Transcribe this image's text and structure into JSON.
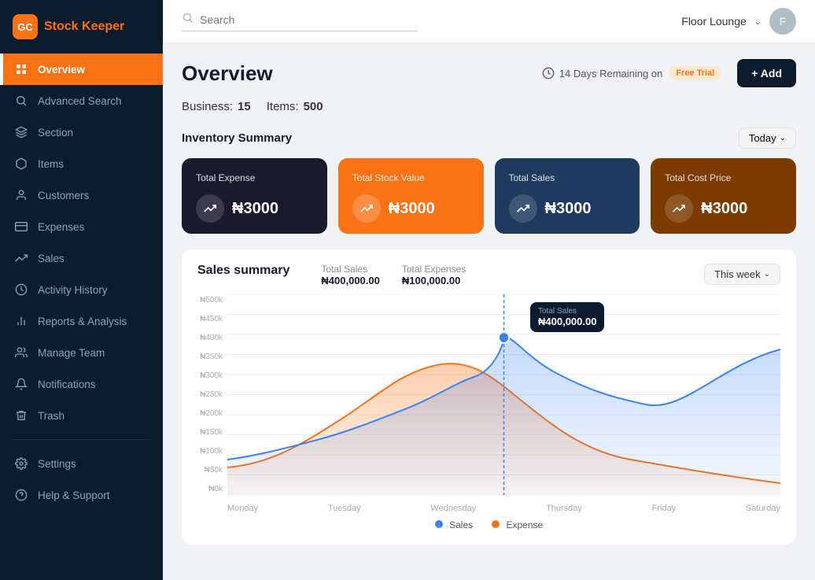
{
  "app": {
    "logo_icon": "GC",
    "logo_name_part1": "Stock",
    "logo_name_part2": "Keeper"
  },
  "sidebar": {
    "items": [
      {
        "id": "overview",
        "label": "Overview",
        "icon": "grid",
        "active": true
      },
      {
        "id": "advanced-search",
        "label": "Advanced Search",
        "icon": "search"
      },
      {
        "id": "section",
        "label": "Section",
        "icon": "layers"
      },
      {
        "id": "items",
        "label": "Items",
        "icon": "box"
      },
      {
        "id": "customers",
        "label": "Customers",
        "icon": "user-circle"
      },
      {
        "id": "expenses",
        "label": "Expenses",
        "icon": "credit-card"
      },
      {
        "id": "sales",
        "label": "Sales",
        "icon": "trending-up"
      },
      {
        "id": "activity-history",
        "label": "Activity History",
        "icon": "clock"
      },
      {
        "id": "reports-analysis",
        "label": "Reports & Analysis",
        "icon": "bar-chart"
      },
      {
        "id": "manage-team",
        "label": "Manage Team",
        "icon": "users"
      },
      {
        "id": "notifications",
        "label": "Notifications",
        "icon": "bell"
      },
      {
        "id": "trash",
        "label": "Trash",
        "icon": "trash"
      }
    ],
    "bottom_items": [
      {
        "id": "settings",
        "label": "Settings",
        "icon": "settings"
      },
      {
        "id": "help-support",
        "label": "Help & Support",
        "icon": "help-circle"
      }
    ]
  },
  "header": {
    "search_placeholder": "Search",
    "user_name": "Floor Lounge",
    "avatar_initial": "F"
  },
  "page": {
    "title": "Overview",
    "trial_text": "14 Days Remaining on",
    "trial_badge": "Free Trial",
    "add_button": "+ Add"
  },
  "stats": {
    "business_label": "Business:",
    "business_value": "15",
    "items_label": "Items:",
    "items_value": "500"
  },
  "inventory_summary": {
    "title": "Inventory Summary",
    "filter": "Today",
    "cards": [
      {
        "label": "Total Expense",
        "amount": "₦3000",
        "style": "black",
        "icon": "↗"
      },
      {
        "label": "Total Stock Value",
        "amount": "₦3000",
        "style": "orange",
        "icon": "↗"
      },
      {
        "label": "Total  Sales",
        "amount": "₦3000",
        "style": "navy",
        "icon": "↗"
      },
      {
        "label": "Total Cost Price",
        "amount": "₦3000",
        "style": "brown",
        "icon": "↗"
      }
    ]
  },
  "sales_summary": {
    "title": "Sales summary",
    "total_sales_label": "Total Sales",
    "total_sales_value": "₦400,000.00",
    "total_expenses_label": "Total Expenses",
    "total_expenses_value": "₦100,000.00",
    "filter": "This week",
    "tooltip": {
      "label": "Total Sales",
      "value": "₦400,000.00"
    },
    "y_axis": [
      "₦500k",
      "₦450k",
      "₦400k",
      "₦350k",
      "₦300k",
      "₦250k",
      "₦200k",
      "₦150k",
      "₦100k",
      "₦50k",
      "₦0k"
    ],
    "x_axis": [
      "Monday",
      "Tuesday",
      "Wednesday",
      "Thursday",
      "Friday",
      "Saturday"
    ],
    "legend": [
      {
        "label": "Sales",
        "color": "#3b82f6"
      },
      {
        "label": "Expense",
        "color": "#f97316"
      }
    ]
  }
}
